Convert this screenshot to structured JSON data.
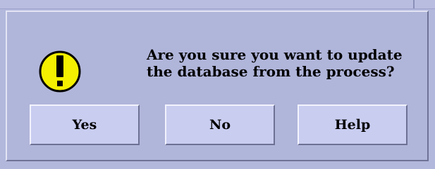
{
  "dialog": {
    "icon": "exclamation-warning-icon",
    "message_line1": "Are you sure you want to update",
    "message_line2": "the database from the process?"
  },
  "buttons": {
    "yes_label": "Yes",
    "no_label": "No",
    "help_label": "Help"
  },
  "colors": {
    "dialog_background": "#b0b5da",
    "button_face": "#c9cdf0",
    "icon_fill": "#f4f000",
    "icon_outline": "#000000"
  }
}
